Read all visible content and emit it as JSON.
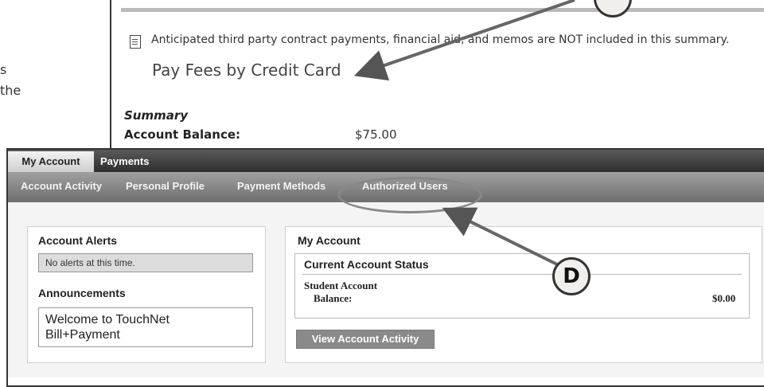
{
  "left_fragments": [
    "s",
    "the"
  ],
  "upper": {
    "notice": "Anticipated third party contract payments, financial aid, and memos are NOT included in this summary.",
    "pay_fees_link": "Pay Fees by Credit Card",
    "summary_title": "Summary",
    "account_balance_label": "Account Balance:",
    "account_balance_value": "$75.00"
  },
  "tabs": [
    "My Account",
    "Payments"
  ],
  "subnav": [
    "Account Activity",
    "Personal Profile",
    "Payment Methods",
    "Authorized Users"
  ],
  "alerts": {
    "title": "Account Alerts",
    "message": "No alerts at this time."
  },
  "announcements": {
    "title": "Announcements",
    "message": "Welcome to TouchNet Bill+Payment"
  },
  "my_account": {
    "title": "My Account",
    "status_title": "Current Account Status",
    "student_account_label": "Student Account",
    "balance_label": "Balance:",
    "balance_value": "$0.00",
    "button_label": "View Account Activity"
  },
  "callouts": {
    "d_label": "D"
  },
  "colors": {
    "nav_dark": "#3a3a3a",
    "subnav_gray": "#8a8a8a",
    "callout_fill": "#f1efeb"
  }
}
